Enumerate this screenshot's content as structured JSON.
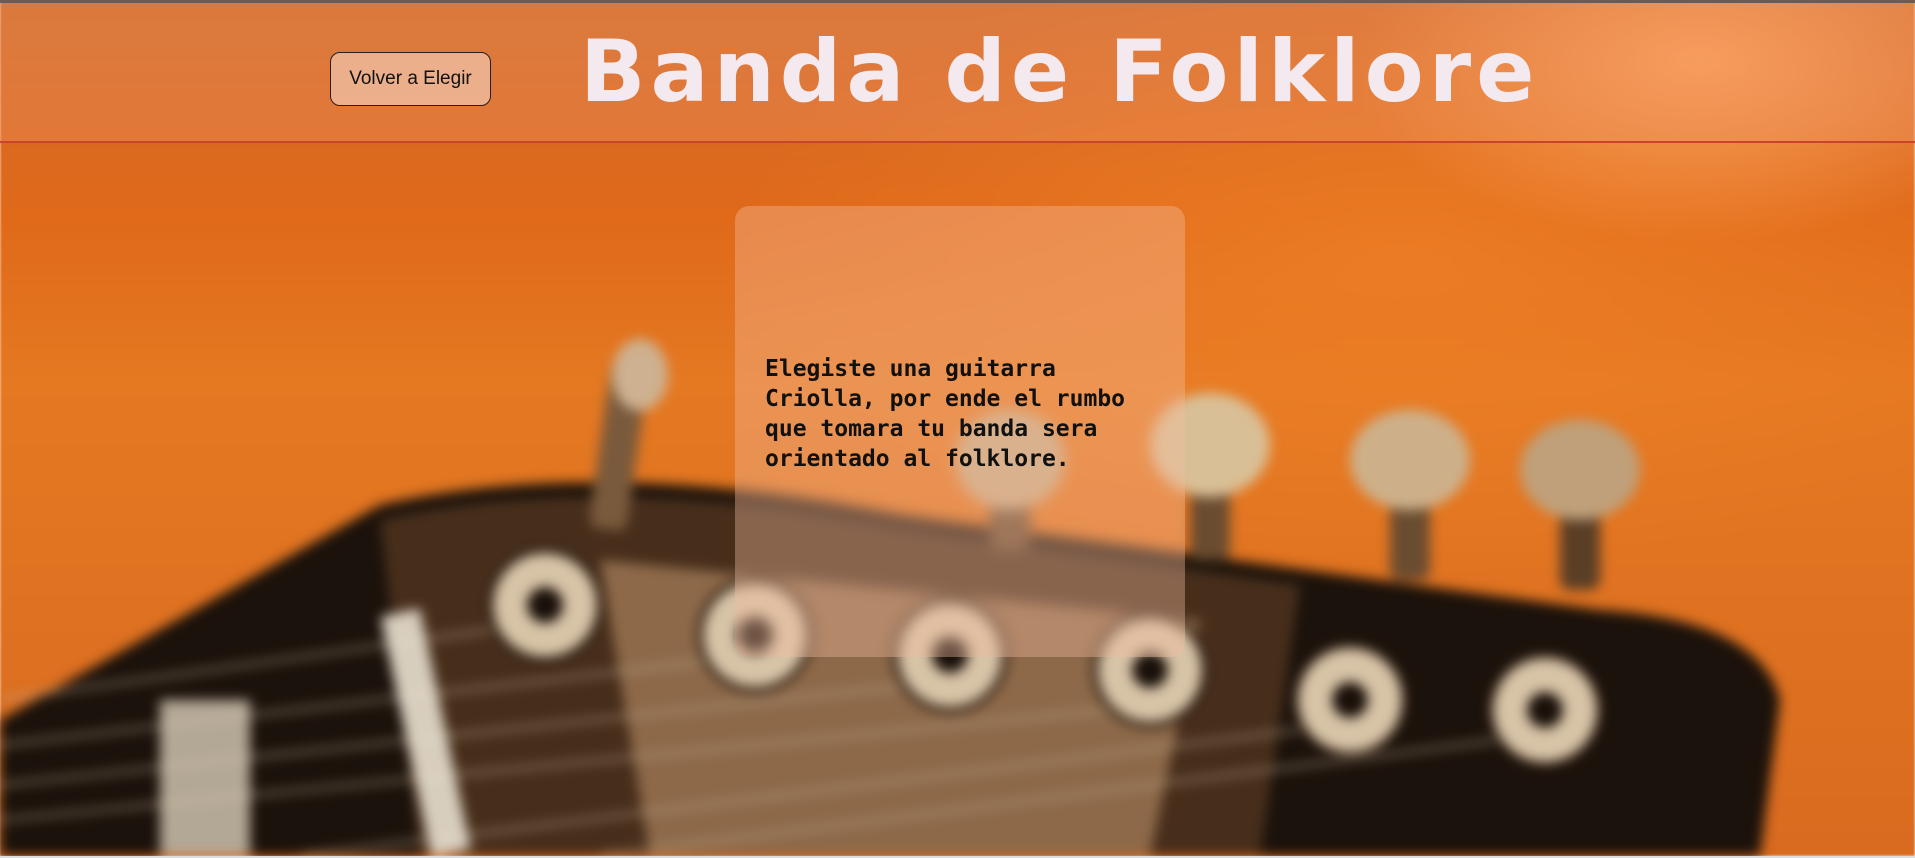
{
  "header": {
    "back_button_label": "Volver a Elegir",
    "title": "Banda de Folklore"
  },
  "card": {
    "message": "Elegiste una guitarra Criolla, por ende el rumbo que tomara tu banda sera orientado al folklore."
  },
  "background": {
    "image": "guitar-headstock-blurred"
  }
}
